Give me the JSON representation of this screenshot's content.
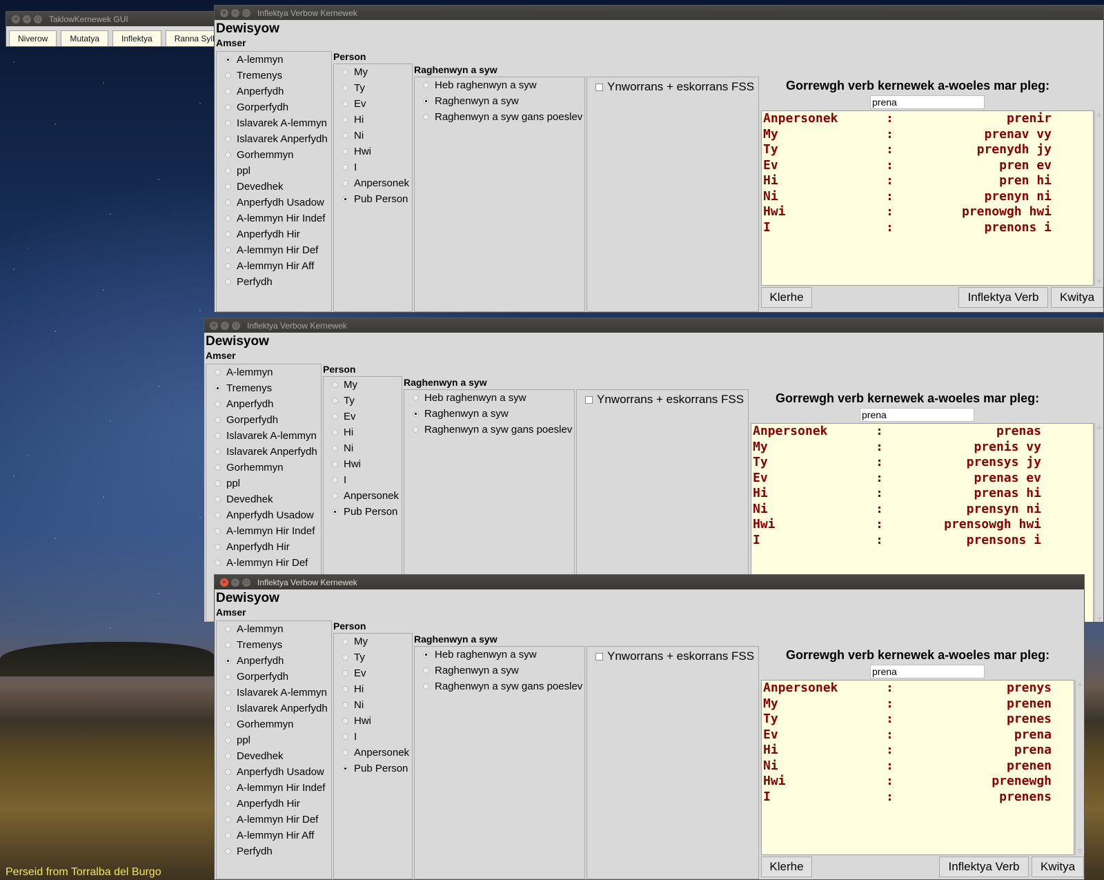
{
  "wallpaper": {
    "caption": "Perseid from Torralba del Burgo"
  },
  "tools_window": {
    "title": "TaklowKernewek GUI",
    "buttons": [
      "Niverow",
      "Mutatya",
      "Inflektya",
      "Ranna Syllab"
    ]
  },
  "windows": [
    {
      "title": "Inflektya Verbow Kernewek",
      "heading": "Dewisyow",
      "amser_label": "Amser",
      "tenses": [
        "A-lemmyn",
        "Tremenys",
        "Anperfydh",
        "Gorperfydh",
        "Islavarek A-lemmyn",
        "Islavarek Anperfydh",
        "Gorhemmyn",
        "ppl",
        "Devedhek",
        "Anperfydh Usadow",
        "A-lemmyn Hir Indef",
        "Anperfydh Hir",
        "A-lemmyn Hir Def",
        "A-lemmyn Hir Aff",
        "Perfydh"
      ],
      "selected_tense": "A-lemmyn",
      "person_label": "Person",
      "persons": [
        "My",
        "Ty",
        "Ev",
        "Hi",
        "Ni",
        "Hwi",
        "I",
        "Anpersonek",
        "Pub Person"
      ],
      "selected_person": "Pub Person",
      "pron_label": "Raghenwyn a syw",
      "pron_options": [
        "Heb raghenwyn a syw",
        "Raghenwyn a syw",
        "Raghenwyn a syw gans poeslev"
      ],
      "selected_pron": "Raghenwyn a syw",
      "fss_label": "Ynworrans + eskorrans FSS",
      "prompt": "Gorrewgh verb kernewek a-woeles mar pleg:",
      "verb": "prena",
      "output": [
        [
          "Anpersonek",
          "prenir"
        ],
        [
          "My",
          "prenav vy"
        ],
        [
          "Ty",
          "prenydh jy"
        ],
        [
          "Ev",
          "pren ev"
        ],
        [
          "Hi",
          "pren hi"
        ],
        [
          "Ni",
          "prenyn ni"
        ],
        [
          "Hwi",
          "prenowgh hwi"
        ],
        [
          "I",
          "prenons i"
        ]
      ],
      "buttons": {
        "clear": "Klerhe",
        "inflect": "Inflektya Verb",
        "quit": "Kwitya"
      }
    },
    {
      "title": "Inflektya Verbow Kernewek",
      "heading": "Dewisyow",
      "amser_label": "Amser",
      "tenses": [
        "A-lemmyn",
        "Tremenys",
        "Anperfydh",
        "Gorperfydh",
        "Islavarek A-lemmyn",
        "Islavarek Anperfydh",
        "Gorhemmyn",
        "ppl",
        "Devedhek",
        "Anperfydh Usadow",
        "A-lemmyn Hir Indef",
        "Anperfydh Hir",
        "A-lemmyn Hir Def"
      ],
      "selected_tense": "Tremenys",
      "person_label": "Person",
      "persons": [
        "My",
        "Ty",
        "Ev",
        "Hi",
        "Ni",
        "Hwi",
        "I",
        "Anpersonek",
        "Pub Person"
      ],
      "selected_person": "Pub Person",
      "pron_label": "Raghenwyn a syw",
      "pron_options": [
        "Heb raghenwyn a syw",
        "Raghenwyn a syw",
        "Raghenwyn a syw gans poeslev"
      ],
      "selected_pron": "Raghenwyn a syw",
      "fss_label": "Ynworrans + eskorrans FSS",
      "prompt": "Gorrewgh verb kernewek a-woeles mar pleg:",
      "verb": "prena",
      "output": [
        [
          "Anpersonek",
          "prenas"
        ],
        [
          "My",
          "prenis vy"
        ],
        [
          "Ty",
          "prensys jy"
        ],
        [
          "Ev",
          "prenas ev"
        ],
        [
          "Hi",
          "prenas hi"
        ],
        [
          "Ni",
          "prensyn ni"
        ],
        [
          "Hwi",
          "prensowgh hwi"
        ],
        [
          "I",
          "prensons i"
        ]
      ]
    },
    {
      "title": "Inflektya Verbow Kernewek",
      "heading": "Dewisyow",
      "amser_label": "Amser",
      "tenses": [
        "A-lemmyn",
        "Tremenys",
        "Anperfydh",
        "Gorperfydh",
        "Islavarek A-lemmyn",
        "Islavarek Anperfydh",
        "Gorhemmyn",
        "ppl",
        "Devedhek",
        "Anperfydh Usadow",
        "A-lemmyn Hir Indef",
        "Anperfydh Hir",
        "A-lemmyn Hir Def",
        "A-lemmyn Hir Aff",
        "Perfydh"
      ],
      "selected_tense": "Anperfydh",
      "person_label": "Person",
      "persons": [
        "My",
        "Ty",
        "Ev",
        "Hi",
        "Ni",
        "Hwi",
        "I",
        "Anpersonek",
        "Pub Person"
      ],
      "selected_person": "Pub Person",
      "pron_label": "Raghenwyn a syw",
      "pron_options": [
        "Heb raghenwyn a syw",
        "Raghenwyn a syw",
        "Raghenwyn a syw gans poeslev"
      ],
      "selected_pron": "Heb raghenwyn a syw",
      "fss_label": "Ynworrans + eskorrans FSS",
      "prompt": "Gorrewgh verb kernewek a-woeles mar pleg:",
      "verb": "prena",
      "output": [
        [
          "Anpersonek",
          "prenys"
        ],
        [
          "My",
          "prenen"
        ],
        [
          "Ty",
          "prenes"
        ],
        [
          "Ev",
          "prena"
        ],
        [
          "Hi",
          "prena"
        ],
        [
          "Ni",
          "prenen"
        ],
        [
          "Hwi",
          "prenewgh"
        ],
        [
          "I",
          "prenens"
        ]
      ],
      "buttons": {
        "clear": "Klerhe",
        "inflect": "Inflektya Verb",
        "quit": "Kwitya"
      }
    }
  ]
}
